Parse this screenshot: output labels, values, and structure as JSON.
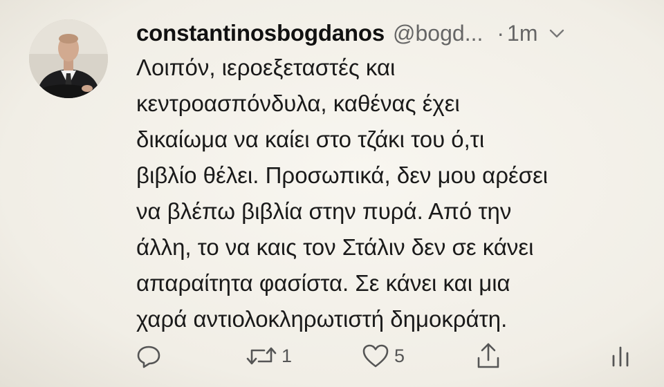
{
  "tweet": {
    "display_name": "constantinosbogdanos",
    "handle": "@bogd...",
    "separator": "·",
    "time": "1m",
    "lines": [
      "Λοιπόν, ιεροεξεταστές και",
      "κεντροασπόνδυλα, καθένας έχει",
      "δικαίωμα να καίει στο τζάκι του ό,τι",
      "βιβλίο θέλει. Προσωπικά, δεν μου αρέσει",
      "να βλέπω βιβλία στην πυρά. Από την",
      "άλλη, το να καις τον Στάλιν δεν σε κάνει",
      "απαραίτητα φασίστα. Σε κάνει και μια",
      "χαρά αντιολοκληρωτιστή δημοκράτη."
    ]
  },
  "actions": {
    "reply": {
      "icon": "reply-icon",
      "count": ""
    },
    "retweet": {
      "icon": "retweet-icon",
      "count": "1"
    },
    "like": {
      "icon": "heart-icon",
      "count": "5"
    },
    "share": {
      "icon": "share-icon",
      "count": ""
    },
    "analytics": {
      "icon": "analytics-icon",
      "count": ""
    }
  },
  "colors": {
    "background": "#f4f1ea",
    "text": "#1a1a1a",
    "muted": "#666666"
  }
}
